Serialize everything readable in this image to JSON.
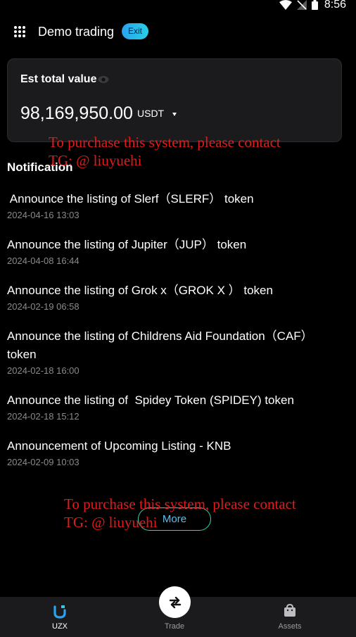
{
  "status_bar": {
    "time": "8:56",
    "icons": [
      "wifi-icon",
      "no-signal-icon",
      "battery-icon"
    ]
  },
  "header": {
    "title": "Demo trading",
    "exit_label": "Exit",
    "menu_icon": "grid-menu-icon"
  },
  "value_card": {
    "label": "Est total value",
    "amount": "98,169,950.00",
    "unit": "USDT",
    "eye_icon": "eye-icon"
  },
  "notifications": {
    "section_title": "Notification",
    "items": [
      {
        "title": " Announce the listing of Slerf（SLERF） token",
        "date": "2024-04-16 13:03"
      },
      {
        "title": "Announce the listing of Jupiter（JUP） token",
        "date": "2024-04-08 16:44"
      },
      {
        "title": "Announce the listing of Grok x（GROK X ） token",
        "date": "2024-02-19 06:58"
      },
      {
        "title": "Announce the listing of Childrens Aid Foundation（CAF） token",
        "date": "2024-02-18 16:00"
      },
      {
        "title": "Announce the listing of  Spidey Token (SPIDEY) token",
        "date": "2024-02-18 15:12"
      },
      {
        "title": "Announcement of Upcoming Listing - KNB",
        "date": "2024-02-09 10:03"
      }
    ],
    "more_label": "More"
  },
  "watermarks": [
    {
      "line1": "To purchase this system, please contact",
      "line2": "TG: @ liuyuehi"
    },
    {
      "line1": "To purchase this system, please contact",
      "line2": "TG: @ liuyuehi"
    }
  ],
  "bottom_nav": {
    "items": [
      {
        "label": "UZX",
        "icon": "uzx-logo-icon",
        "active": true
      },
      {
        "label": "Trade",
        "icon": "swap-arrows-icon",
        "active": false
      },
      {
        "label": "Assets",
        "icon": "wallet-bag-icon",
        "active": false
      }
    ]
  },
  "colors": {
    "accent": "#2aa2f0",
    "watermark": "#e11b1b",
    "card_bg": "#1b1b1d",
    "muted_text": "#8a8a8e"
  }
}
